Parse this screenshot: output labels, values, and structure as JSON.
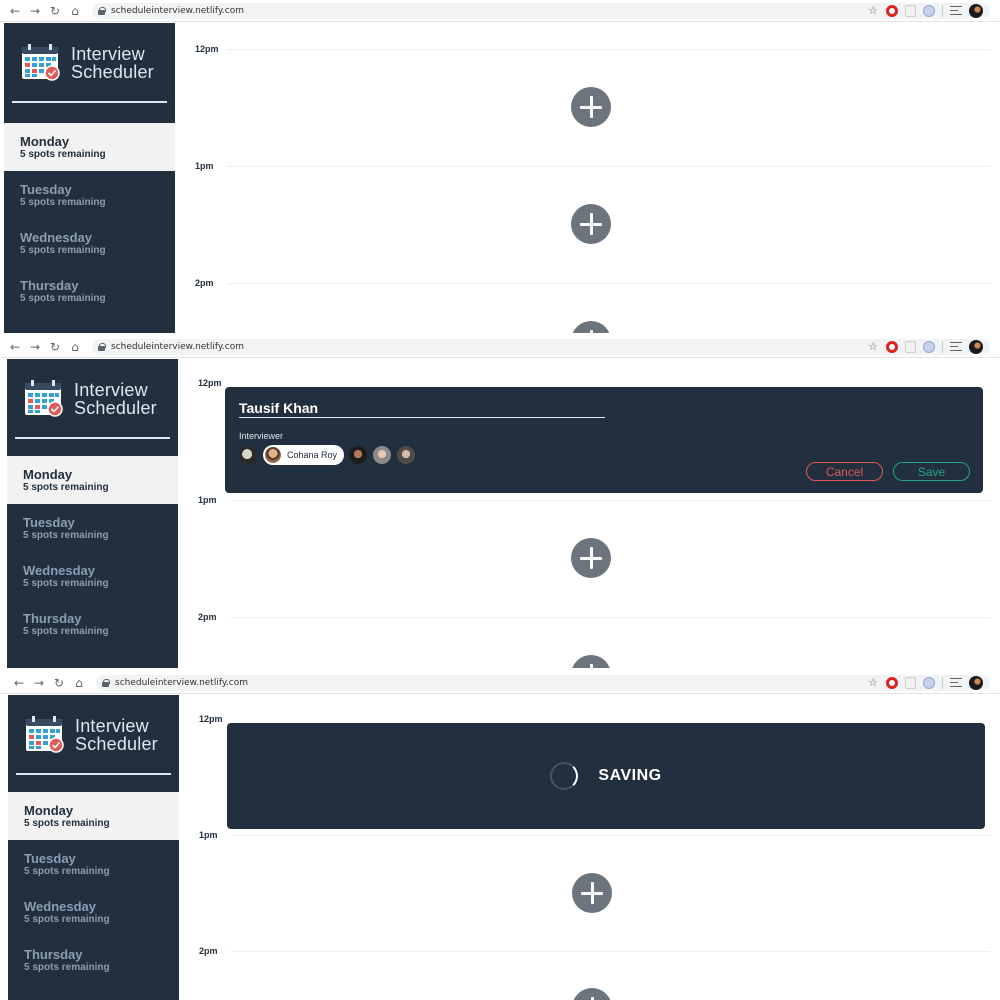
{
  "browser": {
    "url": "scheduleinterview.netlify.com",
    "extensions": [
      "opera-icon",
      "blank-extension-icon",
      "blue-extension-icon",
      "reading-list-icon",
      "profile-avatar-icon"
    ]
  },
  "app": {
    "logo_line1": "Interview",
    "logo_line2": "Scheduler"
  },
  "days": [
    {
      "name": "Monday",
      "spots": "5 spots remaining"
    },
    {
      "name": "Tuesday",
      "spots": "5 spots remaining"
    },
    {
      "name": "Wednesday",
      "spots": "5 spots remaining"
    },
    {
      "name": "Thursday",
      "spots": "5 spots remaining"
    }
  ],
  "selected_day": "Monday",
  "hours": [
    "12pm",
    "1pm",
    "2pm"
  ],
  "form": {
    "student_name": "Tausif Khan",
    "interviewer_label": "Interviewer",
    "selected_interviewer": "Cohana Roy",
    "cancel_label": "Cancel",
    "save_label": "Save"
  },
  "status": {
    "saving_label": "SAVING"
  },
  "colors": {
    "sidebar_bg": "#222f3e",
    "selected_day_bg": "#f2f2f2",
    "add_button": "#6c757d",
    "cancel": "#e05a5a",
    "save": "#26a581"
  }
}
